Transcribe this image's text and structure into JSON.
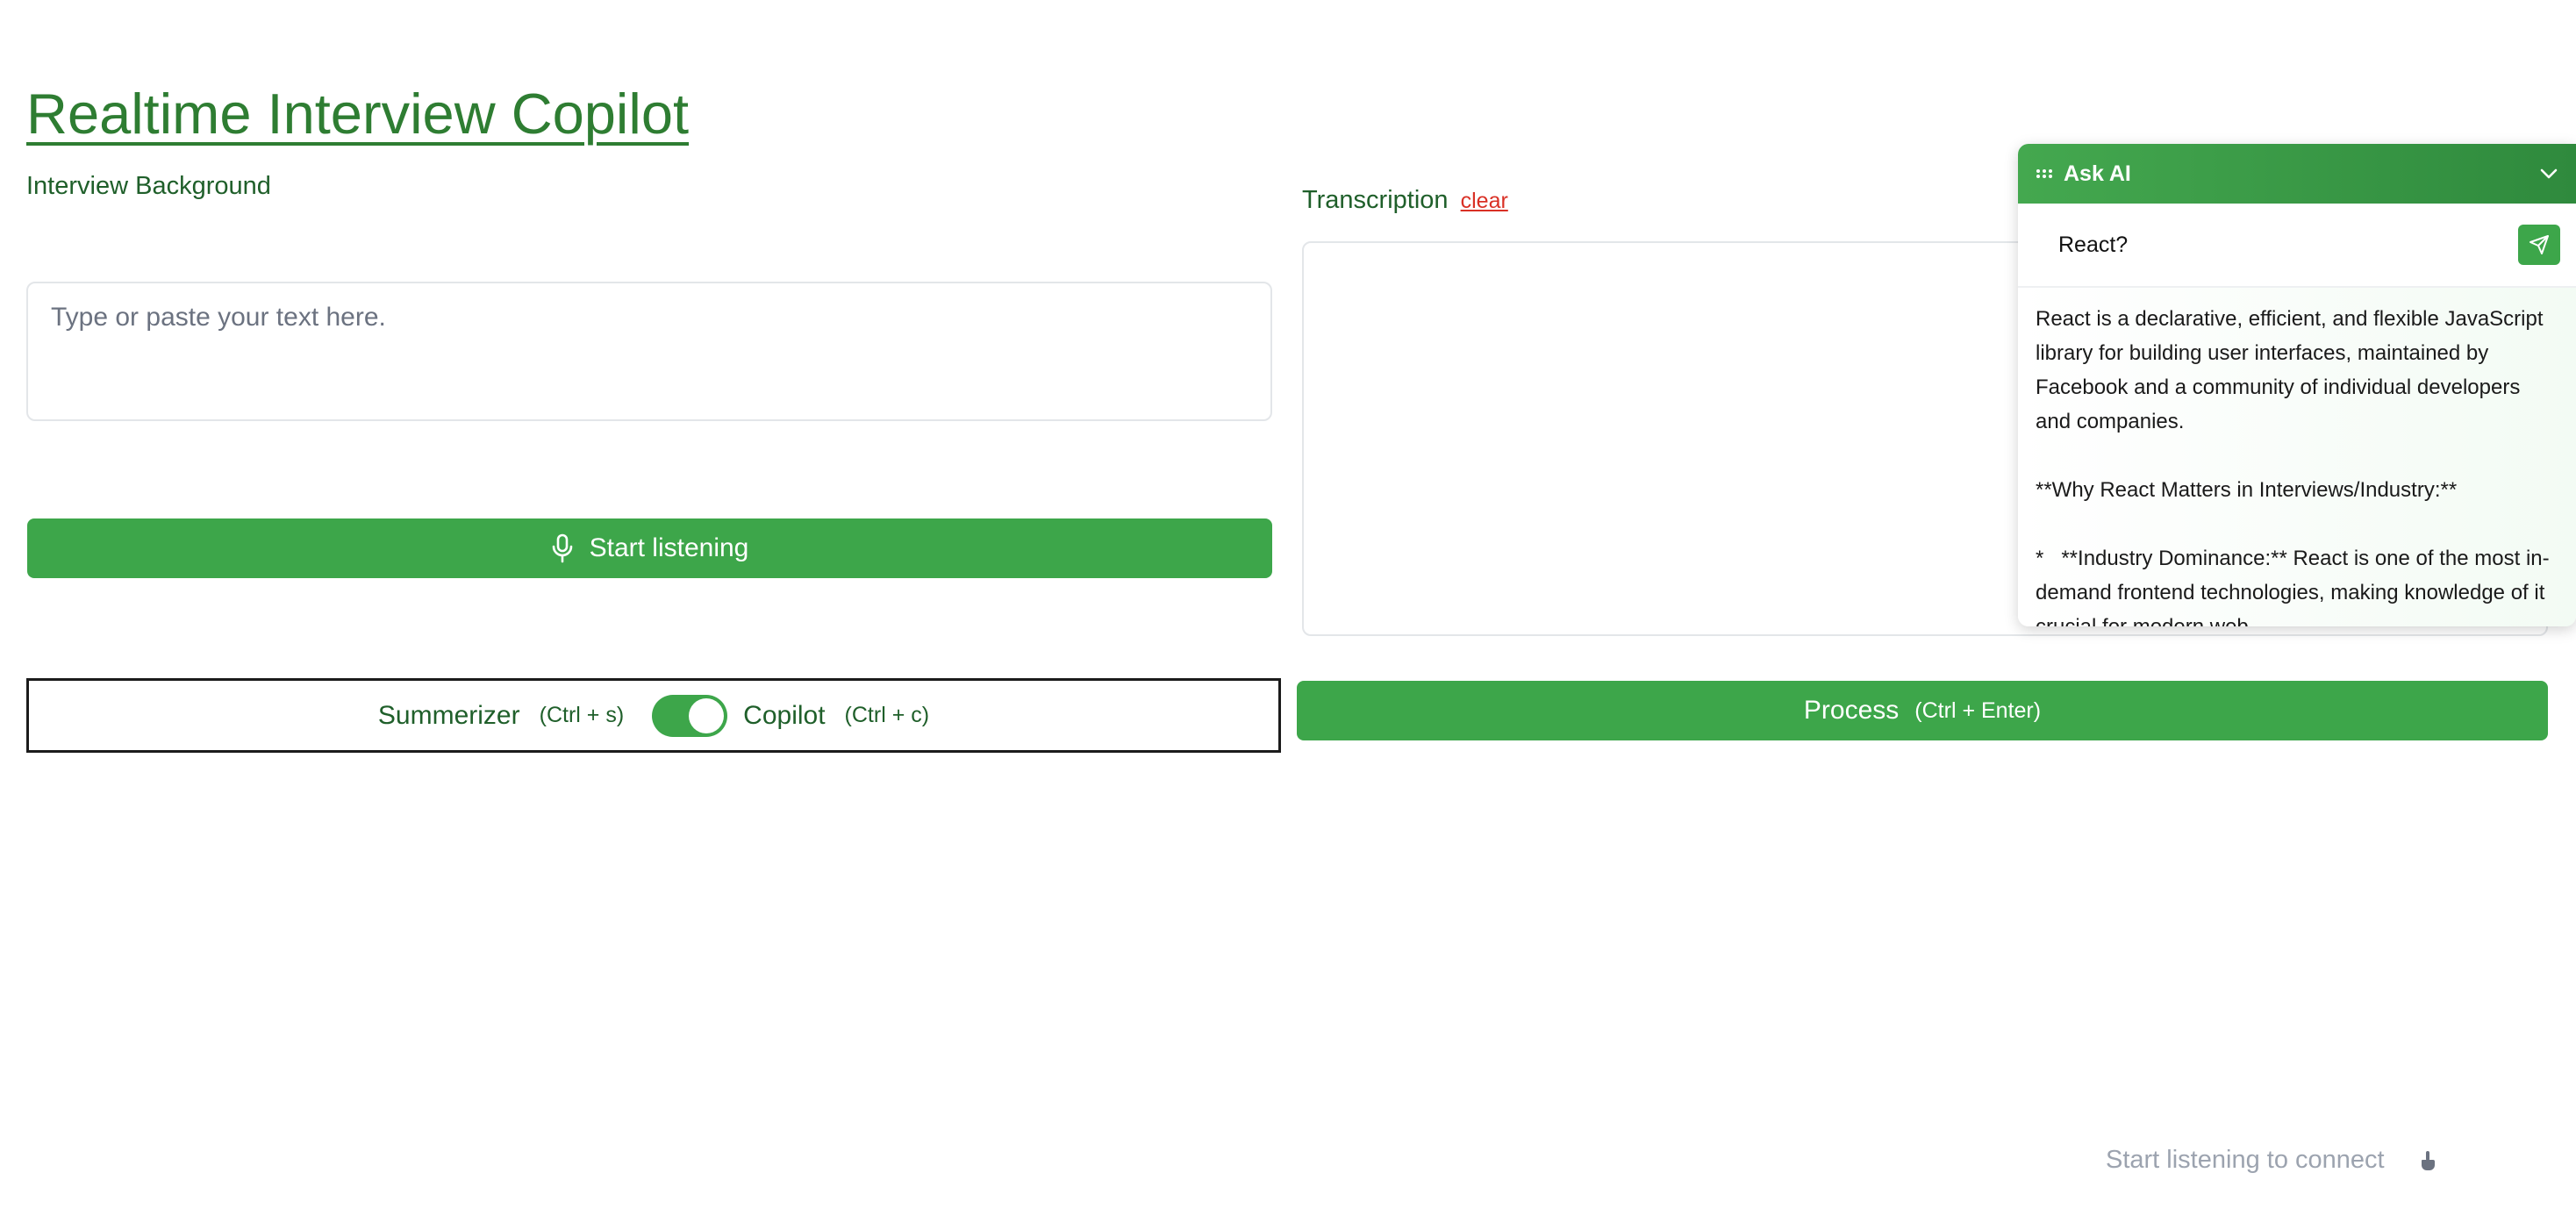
{
  "page": {
    "title": "Realtime Interview Copilot"
  },
  "background": {
    "label": "Interview Background",
    "placeholder": "Type or paste your text here."
  },
  "start_button": {
    "label": "Start listening",
    "icon": "microphone-icon"
  },
  "mode": {
    "summarizer_label": "Summerizer",
    "summarizer_shortcut": "(Ctrl + s)",
    "copilot_label": "Copilot",
    "copilot_shortcut": "(Ctrl + c)",
    "toggle_on": true
  },
  "transcription": {
    "label": "Transcription",
    "clear_label": "clear"
  },
  "process_button": {
    "label": "Process",
    "shortcut": "(Ctrl + Enter)"
  },
  "footer": {
    "status": "Start listening to connect"
  },
  "ask_ai": {
    "title": "Ask AI",
    "query": "React?",
    "answer": [
      "React is a declarative, efficient, and flexible JavaScript library for building user interfaces, maintained by Facebook and a community of individual developers and companies.",
      "**Why React Matters in Interviews/Industry:**",
      "*   **Industry Dominance:** React is one of the most in-demand frontend technologies, making knowledge of it crucial for modern web"
    ]
  },
  "colors": {
    "primary_green": "#3da64a",
    "title_green": "#2e7d32",
    "text_green": "#1f5f2a",
    "clear_red": "#d93025",
    "muted_gray": "#9ca3af"
  }
}
